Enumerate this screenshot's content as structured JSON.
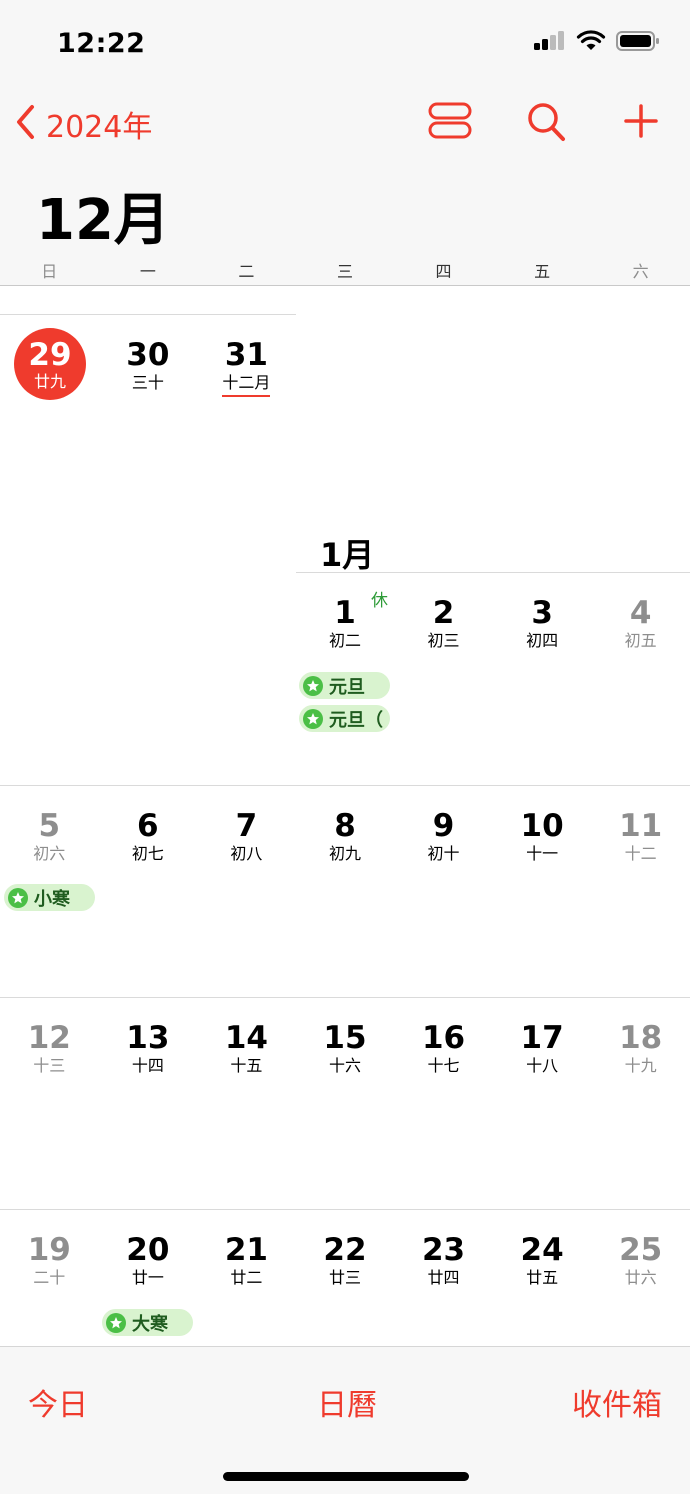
{
  "status": {
    "time": "12:22"
  },
  "nav": {
    "back_label": "2024年"
  },
  "month_title": "12月",
  "weekdays": [
    "日",
    "一",
    "二",
    "三",
    "四",
    "五",
    "六"
  ],
  "dec_week": [
    {
      "day": "29",
      "lunar": "廿九"
    },
    {
      "day": "30",
      "lunar": "三十"
    },
    {
      "day": "31",
      "lunar": "十二月"
    }
  ],
  "jan_label": "1月",
  "rest_badge": "休",
  "week1": [
    {
      "day": "1",
      "lunar": "初二"
    },
    {
      "day": "2",
      "lunar": "初三"
    },
    {
      "day": "3",
      "lunar": "初四"
    },
    {
      "day": "4",
      "lunar": "初五"
    }
  ],
  "week2": [
    {
      "day": "5",
      "lunar": "初六"
    },
    {
      "day": "6",
      "lunar": "初七"
    },
    {
      "day": "7",
      "lunar": "初八"
    },
    {
      "day": "8",
      "lunar": "初九"
    },
    {
      "day": "9",
      "lunar": "初十"
    },
    {
      "day": "10",
      "lunar": "十一"
    },
    {
      "day": "11",
      "lunar": "十二"
    }
  ],
  "week3": [
    {
      "day": "12",
      "lunar": "十三"
    },
    {
      "day": "13",
      "lunar": "十四"
    },
    {
      "day": "14",
      "lunar": "十五"
    },
    {
      "day": "15",
      "lunar": "十六"
    },
    {
      "day": "16",
      "lunar": "十七"
    },
    {
      "day": "17",
      "lunar": "十八"
    },
    {
      "day": "18",
      "lunar": "十九"
    }
  ],
  "week4": [
    {
      "day": "19",
      "lunar": "二十"
    },
    {
      "day": "20",
      "lunar": "廿一"
    },
    {
      "day": "21",
      "lunar": "廿二"
    },
    {
      "day": "22",
      "lunar": "廿三"
    },
    {
      "day": "23",
      "lunar": "廿四"
    },
    {
      "day": "24",
      "lunar": "廿五"
    },
    {
      "day": "25",
      "lunar": "廿六"
    }
  ],
  "events": {
    "jan1_a": "元旦",
    "jan1_b": "元旦（",
    "jan5": "小寒",
    "jan20": "大寒"
  },
  "tabs": {
    "today": "今日",
    "calendars": "日曆",
    "inbox": "收件箱"
  },
  "colors": {
    "accent": "#ef3b2d",
    "event_bg": "#d9f3cf",
    "event_dot": "#4bbf46"
  }
}
